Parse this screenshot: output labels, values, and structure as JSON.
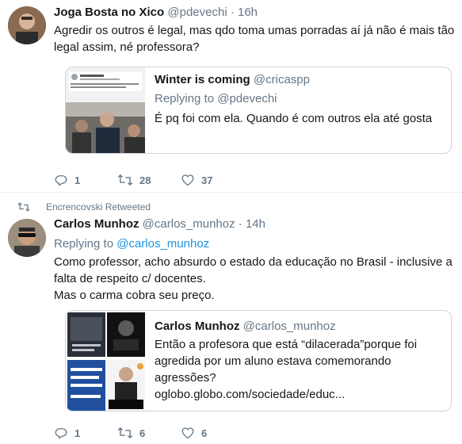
{
  "tweet1": {
    "name": "Joga Bosta no Xico",
    "handle": "@pdevechi",
    "dot": "·",
    "time": "16h",
    "text": "Agredir os outros é legal, mas qdo toma umas porradas aí já não é mais tão legal assim, né professora?",
    "quote": {
      "name": "Winter is coming",
      "handle": "@cricaspp",
      "replying_prefix": "Replying to",
      "replying_handle": "@pdevechi",
      "text": "É pq foi com ela. Quando é com outros ela até gosta"
    },
    "actions": {
      "reply_count": "1",
      "retweet_count": "28",
      "like_count": "37"
    }
  },
  "tweet2": {
    "retweeted_by": "Encrencovski Retweeted",
    "name": "Carlos Munhoz",
    "handle": "@carlos_munhoz",
    "dot": "·",
    "time": "14h",
    "replying_prefix": "Replying to",
    "replying_handle": "@carlos_munhoz",
    "text_line1": "Como professor, acho absurdo o estado da educação no Brasil - inclusive a falta de respeito c/ docentes.",
    "text_line2": "Mas o carma cobra seu preço.",
    "quote": {
      "name": "Carlos Munhoz",
      "handle": "@carlos_munhoz",
      "text": "Então a profesora que está “dilacerada”porque foi agredida por um aluno estava comemorando agressões?",
      "link": "oglobo.globo.com/sociedade/educ..."
    },
    "actions": {
      "reply_count": "1",
      "retweet_count": "6",
      "like_count": "6"
    }
  },
  "colors": {
    "secondary_text": "#657786",
    "link": "#1b95e0",
    "border": "#e6ecf0"
  },
  "icons": [
    "reply-icon",
    "retweet-icon",
    "like-icon"
  ]
}
